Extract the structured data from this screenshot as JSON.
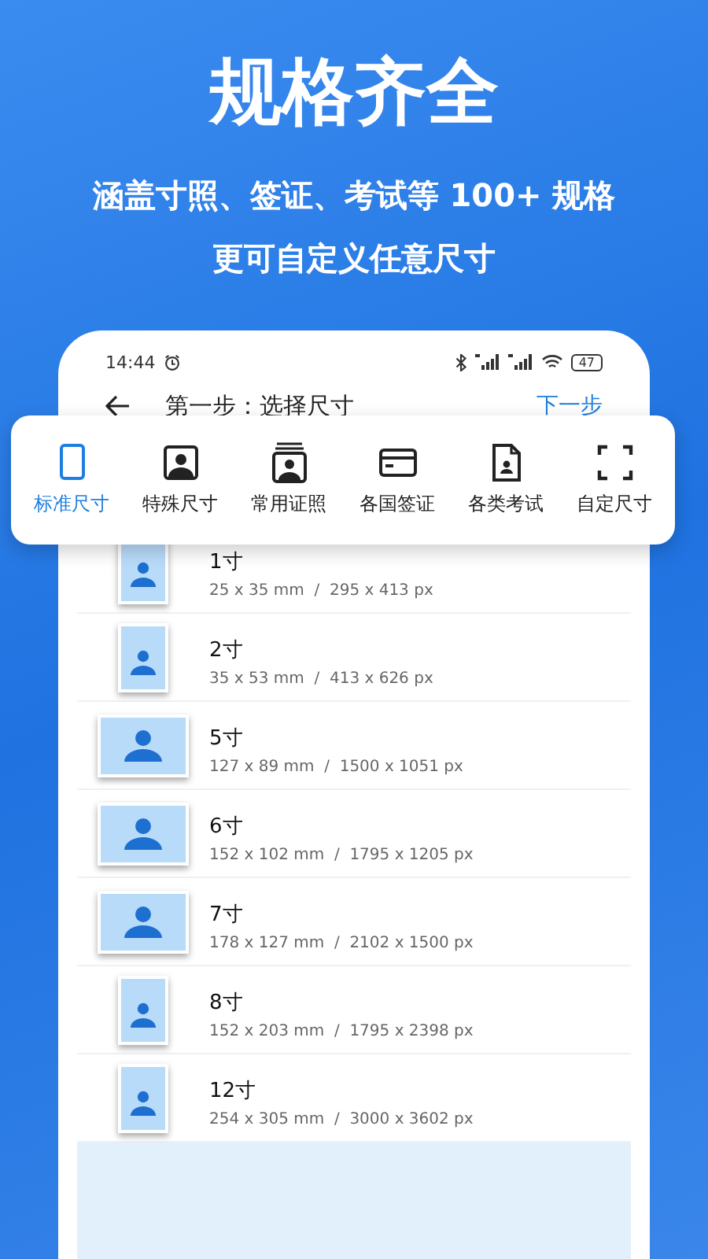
{
  "headline": "规格齐全",
  "subtitle_lines": [
    "涵盖寸照、签证、考试等 100+ 规格",
    "更可自定义任意尺寸"
  ],
  "status_bar": {
    "time": "14:44",
    "battery": "47"
  },
  "app_bar": {
    "title": "第一步：选择尺寸",
    "action": "下一步"
  },
  "tabs": [
    {
      "label": "标准尺寸",
      "kind": "blank",
      "selected": true
    },
    {
      "label": "特殊尺寸",
      "kind": "portrait",
      "selected": false
    },
    {
      "label": "常用证照",
      "kind": "stack",
      "selected": false
    },
    {
      "label": "各国签证",
      "kind": "card",
      "selected": false
    },
    {
      "label": "各类考试",
      "kind": "document",
      "selected": false
    },
    {
      "label": "自定尺寸",
      "kind": "frame",
      "selected": false
    }
  ],
  "sizes": [
    {
      "name": "1寸",
      "spec": "25 x 35 mm  /  295 x 413 px",
      "kind": "portrait"
    },
    {
      "name": "2寸",
      "spec": "35 x 53 mm  /  413 x 626 px",
      "kind": "portrait"
    },
    {
      "name": "5寸",
      "spec": "127 x 89 mm  /  1500 x 1051 px",
      "kind": "landscape"
    },
    {
      "name": "6寸",
      "spec": "152 x 102 mm  /  1795 x 1205 px",
      "kind": "landscape"
    },
    {
      "name": "7寸",
      "spec": "178 x 127 mm  /  2102 x 1500 px",
      "kind": "landscape"
    },
    {
      "name": "8寸",
      "spec": "152 x 203 mm  /  1795 x 2398 px",
      "kind": "portrait"
    },
    {
      "name": "12寸",
      "spec": "254 x 305 mm  /  3000 x 3602 px",
      "kind": "portrait"
    }
  ]
}
